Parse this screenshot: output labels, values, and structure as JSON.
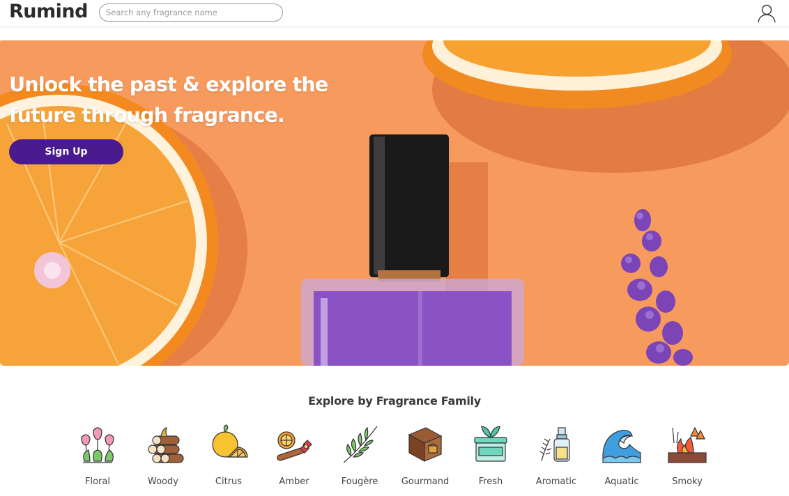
{
  "header": {
    "logo": "Rumind",
    "search_placeholder": "Search any fragrance name",
    "user_icon": "user-icon"
  },
  "hero": {
    "title": "Unlock the past & explore the future through fragrance.",
    "signup_label": "Sign Up"
  },
  "families": {
    "title": "Explore by Fragrance Family",
    "items": [
      {
        "label": "Floral",
        "icon": "tulips-icon"
      },
      {
        "label": "Woody",
        "icon": "logs-icon"
      },
      {
        "label": "Citrus",
        "icon": "citrus-icon"
      },
      {
        "label": "Amber",
        "icon": "amber-spice-icon"
      },
      {
        "label": "Fougère",
        "icon": "fern-leaf-icon"
      },
      {
        "label": "Gourmand",
        "icon": "chocolate-icon"
      },
      {
        "label": "Fresh",
        "icon": "fresh-jar-icon"
      },
      {
        "label": "Aromatic",
        "icon": "aromatic-oil-icon"
      },
      {
        "label": "Aquatic",
        "icon": "wave-icon"
      },
      {
        "label": "Smoky",
        "icon": "fire-icon"
      }
    ]
  },
  "colors": {
    "hero_bg": "#f79a5e",
    "signup": "#4a1a8f",
    "perfume": "#8b52c6"
  }
}
